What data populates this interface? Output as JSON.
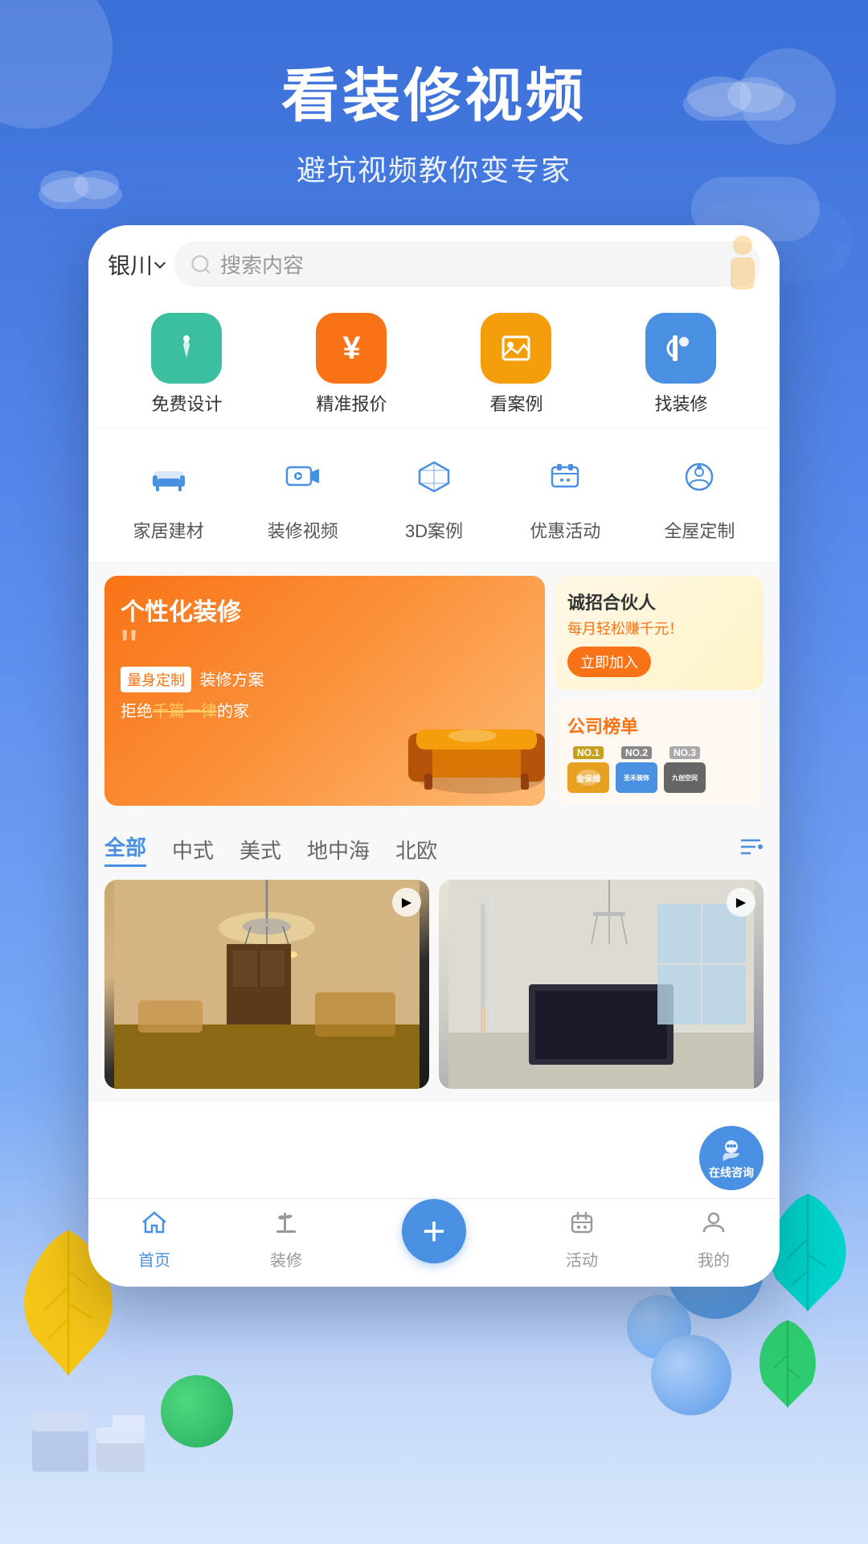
{
  "app": {
    "title": "看装修视频",
    "subtitle": "避坑视频教你变专家"
  },
  "header": {
    "city": "银川",
    "search_placeholder": "搜索内容"
  },
  "menu_row1": [
    {
      "label": "免费设计",
      "color": "#3bbfa0",
      "icon": "✏️"
    },
    {
      "label": "精准报价",
      "color": "#f97316",
      "icon": "¥"
    },
    {
      "label": "看案例",
      "color": "#f59e0b",
      "icon": "🖼️"
    },
    {
      "label": "找装修",
      "color": "#4a90e2",
      "icon": "🖌️"
    }
  ],
  "menu_row2": [
    {
      "label": "家居建材",
      "icon": "🛋️"
    },
    {
      "label": "装修视频",
      "icon": "📹"
    },
    {
      "label": "3D案例",
      "icon": "⬡"
    },
    {
      "label": "优惠活动",
      "icon": "🎁"
    },
    {
      "label": "全屋定制",
      "icon": "📷"
    }
  ],
  "left_banner": {
    "title": "个性化装修",
    "tag": "量身定制",
    "desc": "装修方案",
    "subdesc": "拒绝千篇一律的家"
  },
  "partner_banner": {
    "title": "诚招合伙人",
    "subtitle": "每月轻松赚千元！",
    "button": "立即加入"
  },
  "rank_banner": {
    "title": "公司",
    "title_accent": "榜单",
    "companies": [
      {
        "rank": "NO.1",
        "name": "金保姆",
        "color": "#e8a020"
      },
      {
        "rank": "NO.2",
        "name": "圣禾装饰",
        "color": "#4a90e2"
      },
      {
        "rank": "NO.3",
        "name": "九创空间",
        "color": "#666"
      }
    ]
  },
  "filter_tabs": [
    {
      "label": "全部",
      "active": true
    },
    {
      "label": "中式",
      "active": false
    },
    {
      "label": "美式",
      "active": false
    },
    {
      "label": "地中海",
      "active": false
    },
    {
      "label": "北欧",
      "active": false
    }
  ],
  "bottom_nav": [
    {
      "label": "首页",
      "active": true,
      "icon": "🏠"
    },
    {
      "label": "装修",
      "active": false,
      "icon": "✏️"
    },
    {
      "label": "+",
      "active": false,
      "icon": "+"
    },
    {
      "label": "活动",
      "active": false,
      "icon": "🎁"
    },
    {
      "label": "我的",
      "active": false,
      "icon": "👤"
    }
  ],
  "consult_btn": "在线咨询"
}
